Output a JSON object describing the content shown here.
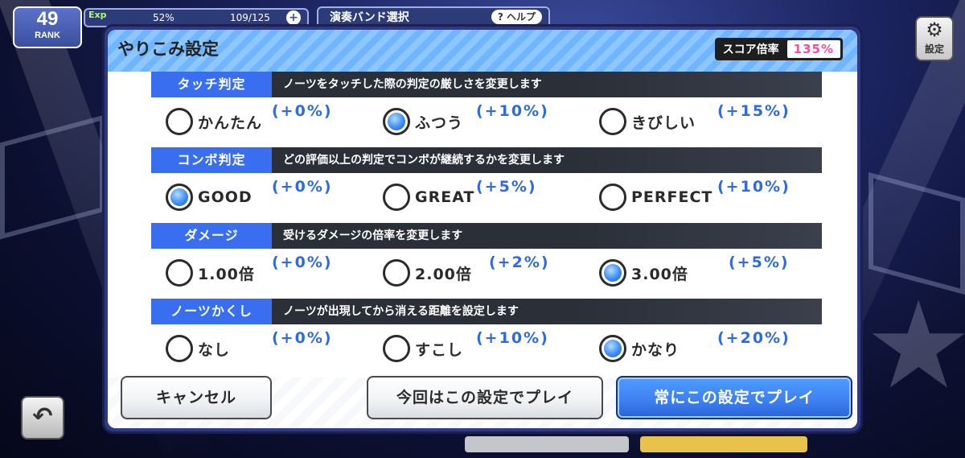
{
  "hud": {
    "rank_value": "49",
    "rank_label": "RANK",
    "exp_label": "Exp",
    "exp_percent": "52%",
    "stamina": "109/125",
    "title": "演奏バンド選択",
    "help_label": "ヘルプ"
  },
  "side_settings_label": "設定",
  "dialog": {
    "title": "やりこみ設定",
    "score_label": "スコア倍率",
    "score_value": "135%"
  },
  "sections": [
    {
      "label": "タッチ判定",
      "description": "ノーツをタッチした際の判定の厳しさを変更します",
      "selected": 1,
      "options": [
        {
          "label": "かんたん",
          "bonus": "(+0%)"
        },
        {
          "label": "ふつう",
          "bonus": "(+10%)"
        },
        {
          "label": "きびしい",
          "bonus": "(+15%)"
        }
      ]
    },
    {
      "label": "コンボ判定",
      "description": "どの評価以上の判定でコンボが継続するかを変更します",
      "selected": 0,
      "options": [
        {
          "label": "GOOD",
          "bonus": "(+0%)"
        },
        {
          "label": "GREAT",
          "bonus": "(+5%)"
        },
        {
          "label": "PERFECT",
          "bonus": "(+10%)"
        }
      ]
    },
    {
      "label": "ダメージ",
      "description": "受けるダメージの倍率を変更します",
      "selected": 2,
      "options": [
        {
          "label": "1.00倍",
          "bonus": "(+0%)"
        },
        {
          "label": "2.00倍",
          "bonus": "(+2%)"
        },
        {
          "label": "3.00倍",
          "bonus": "(+5%)"
        }
      ]
    },
    {
      "label": "ノーツかくし",
      "description": "ノーツが出現してから消える距離を設定します",
      "selected": 2,
      "options": [
        {
          "label": "なし",
          "bonus": "(+0%)"
        },
        {
          "label": "すこし",
          "bonus": "(+10%)"
        },
        {
          "label": "かなり",
          "bonus": "(+20%)"
        }
      ]
    }
  ],
  "buttons": {
    "cancel": "キャンセル",
    "play_once": "今回はこの設定でプレイ",
    "play_always": "常にこの設定でプレイ"
  },
  "colors": {
    "accent_blue": "#3a6ef0",
    "bonus_text": "#2e6ae0",
    "score_value": "#ff4a9a",
    "header_stripe": "#6fb5ff"
  },
  "icons": {
    "settings": "gear-music-icon",
    "back": "back-arrow-icon",
    "rank_gem": "gem-icon",
    "stamina": "guitar-icon"
  }
}
